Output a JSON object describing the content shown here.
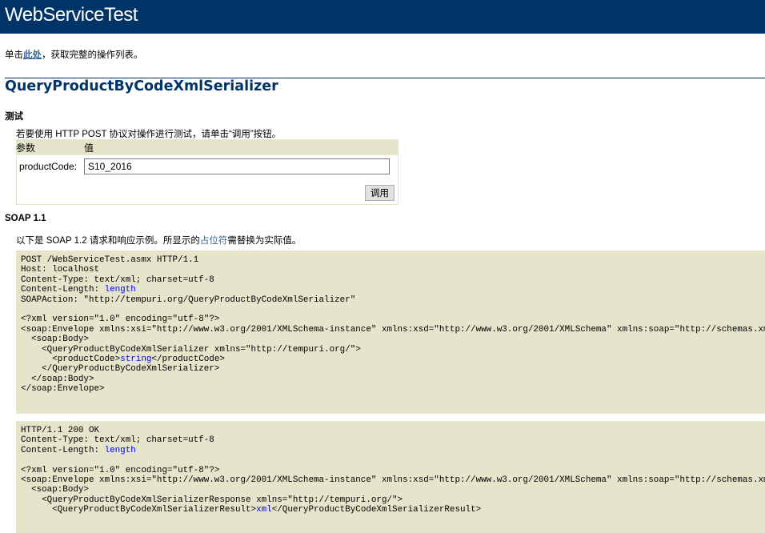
{
  "page": {
    "title": "WebServiceTest",
    "intro": {
      "prefix": "单击",
      "link": "此处",
      "suffix": "，获取完整的操作列表。"
    },
    "operation_name": "QueryProductByCodeXmlSerializer"
  },
  "test": {
    "heading": "测试",
    "instructions": "若要使用 HTTP POST 协议对操作进行测试，请单击“调用”按钮。",
    "col_param": "参数",
    "col_value": "值",
    "param_label": "productCode:",
    "param_value": "S10_2016",
    "invoke_label": "调用"
  },
  "soap": {
    "heading": "SOAP 1.1",
    "desc_prefix": "以下是 SOAP 1.2 请求和响应示例。所显示的",
    "desc_placeholder": "占位符",
    "desc_suffix": "需替换为实际值。",
    "request": {
      "line1": "POST /WebServiceTest.asmx HTTP/1.1",
      "line2": "Host: localhost",
      "line3": "Content-Type: text/xml; charset=utf-8",
      "line4_key": "Content-Length: ",
      "line4_val": "length",
      "line5": "SOAPAction: \"http://tempuri.org/QueryProductByCodeXmlSerializer\"",
      "xml1": "<?xml version=\"1.0\" encoding=\"utf-8\"?>",
      "xml2": "<soap:Envelope xmlns:xsi=\"http://www.w3.org/2001/XMLSchema-instance\" xmlns:xsd=\"http://www.w3.org/2001/XMLSchema\" xmlns:soap=\"http://schemas.xmlsoap.org/soap/envelope/\">",
      "xml3": "  <soap:Body>",
      "xml4": "    <QueryProductByCodeXmlSerializer xmlns=\"http://tempuri.org/\">",
      "xml5_open": "      <productCode>",
      "xml5_val": "string",
      "xml5_close": "</productCode>",
      "xml6": "    </QueryProductByCodeXmlSerializer>",
      "xml7": "  </soap:Body>",
      "xml8": "</soap:Envelope>"
    },
    "response": {
      "line1": "HTTP/1.1 200 OK",
      "line2": "Content-Type: text/xml; charset=utf-8",
      "line3_key": "Content-Length: ",
      "line3_val": "length",
      "xml1": "<?xml version=\"1.0\" encoding=\"utf-8\"?>",
      "xml2": "<soap:Envelope xmlns:xsi=\"http://www.w3.org/2001/XMLSchema-instance\" xmlns:xsd=\"http://www.w3.org/2001/XMLSchema\" xmlns:soap=\"http://schemas.xmlsoap.org/soap/envelope/\">",
      "xml3": "  <soap:Body>",
      "xml4": "    <QueryProductByCodeXmlSerializerResponse xmlns=\"http://tempuri.org/\">",
      "xml5_open": "      <QueryProductByCodeXmlSerializerResult>",
      "xml5_val": "xml",
      "xml5_close": "</QueryProductByCodeXmlSerializerResult>"
    }
  }
}
